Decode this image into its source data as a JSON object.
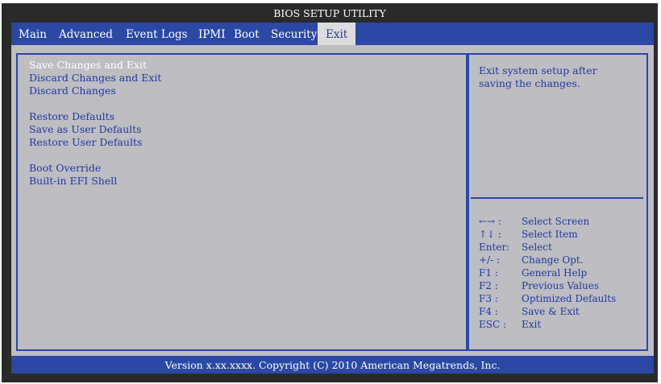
{
  "title": "BIOS SETUP UTILITY",
  "tabs": [
    {
      "label": "Main"
    },
    {
      "label": "Advanced"
    },
    {
      "label": "Event Logs"
    },
    {
      "label": "IPMI"
    },
    {
      "label": "Boot"
    },
    {
      "label": "Security"
    },
    {
      "label": "Exit",
      "active": true
    }
  ],
  "menu": [
    {
      "label": "Save Changes and Exit",
      "selected": true
    },
    {
      "label": "Discard Changes and Exit"
    },
    {
      "label": "Discard Changes"
    },
    {
      "label": "Restore Defaults"
    },
    {
      "label": "Save as User Defaults"
    },
    {
      "label": "Restore User Defaults"
    },
    {
      "label": "Boot Override"
    },
    {
      "label": "Built-in EFI Shell"
    }
  ],
  "help": {
    "text": "Exit system setup after saving the changes."
  },
  "keys": [
    {
      "key": "←→ :",
      "desc": "Select Screen"
    },
    {
      "key": "↑↓  :",
      "desc": "Select Item"
    },
    {
      "key": "Enter:",
      "desc": "Select"
    },
    {
      "key": "+/- :",
      "desc": "Change Opt."
    },
    {
      "key": "F1 :",
      "desc": "General Help"
    },
    {
      "key": "F2 :",
      "desc": "Previous Values"
    },
    {
      "key": "F3 :",
      "desc": "Optimized Defaults"
    },
    {
      "key": "F4 :",
      "desc": "Save & Exit"
    },
    {
      "key": "ESC :",
      "desc": "Exit"
    }
  ],
  "footer": "Version x.xx.xxxx. Copyright (C) 2010 American Megatrends, Inc.",
  "colors": {
    "frame": "#2a2a2a",
    "accent_blue": "#2a48a4",
    "panel_gray": "#bdbdc2",
    "text_blue": "#1f3aa0",
    "highlight": "#ffffff"
  }
}
